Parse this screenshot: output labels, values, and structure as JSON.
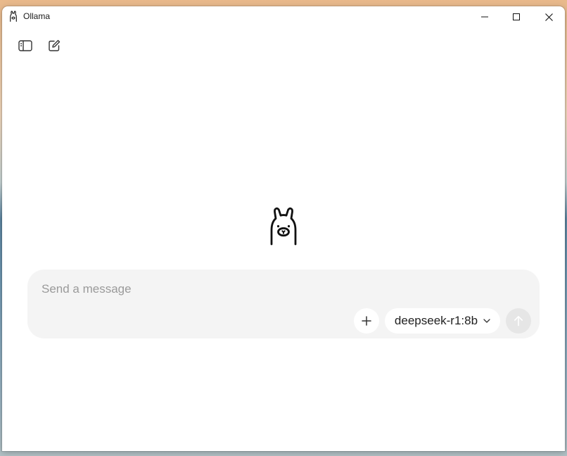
{
  "window": {
    "title": "Ollama"
  },
  "titlebar": {
    "icons": [
      "llama-icon",
      "minimize-icon",
      "maximize-icon",
      "close-icon"
    ]
  },
  "toolbar": {
    "icons": [
      "sidebar-toggle-icon",
      "new-chat-icon"
    ]
  },
  "composer": {
    "placeholder": "Send a message",
    "value": "",
    "model": "deepseek-r1:8b",
    "icons": [
      "plus-icon",
      "chevron-down-icon",
      "arrow-up-icon"
    ]
  },
  "colors": {
    "composer_bg": "#f4f4f4",
    "placeholder": "#9a9a9a",
    "send_disabled_bg": "#e6e6e6",
    "text": "#1f1f1f"
  }
}
